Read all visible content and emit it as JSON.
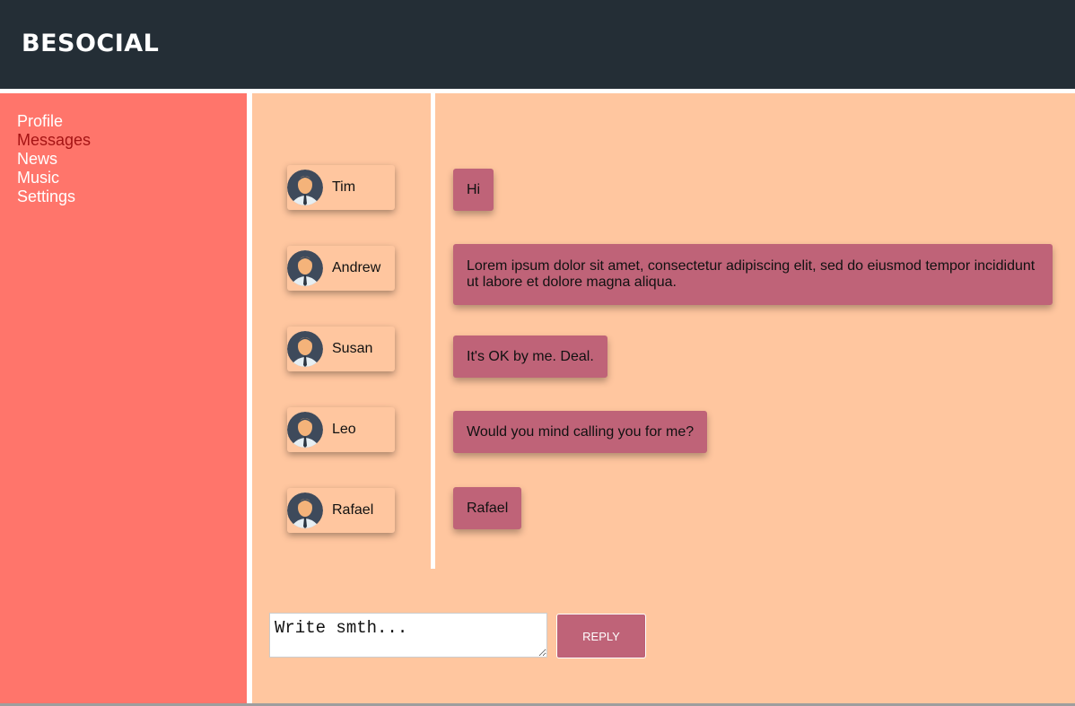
{
  "header": {
    "logo": "BESOCIAL"
  },
  "sidebar": {
    "items": [
      {
        "label": "Profile"
      },
      {
        "label": "Messages",
        "active": true
      },
      {
        "label": "News"
      },
      {
        "label": "Music"
      },
      {
        "label": "Settings"
      }
    ]
  },
  "dialogs": [
    {
      "name": "Tim"
    },
    {
      "name": "Andrew"
    },
    {
      "name": "Susan"
    },
    {
      "name": "Leo"
    },
    {
      "name": "Rafael"
    }
  ],
  "messages": [
    {
      "text": "Hi"
    },
    {
      "text": "Lorem ipsum dolor sit amet, consectetur adipiscing elit, sed do eiusmod tempor incididunt ut labore et dolore magna aliqua."
    },
    {
      "text": "It's OK by me. Deal."
    },
    {
      "text": "Would you mind calling you for me?"
    },
    {
      "text": "Rafael"
    }
  ],
  "composer": {
    "placeholder": "Write smth...",
    "reply_label": "Reply"
  },
  "colors": {
    "header_bg": "#242e36",
    "sidebar_bg": "#ff756b",
    "active_nav": "#a51414",
    "content_bg": "#ffc69f",
    "message_bg": "#bf6378"
  },
  "icons": {
    "avatar": "user-avatar-icon"
  }
}
